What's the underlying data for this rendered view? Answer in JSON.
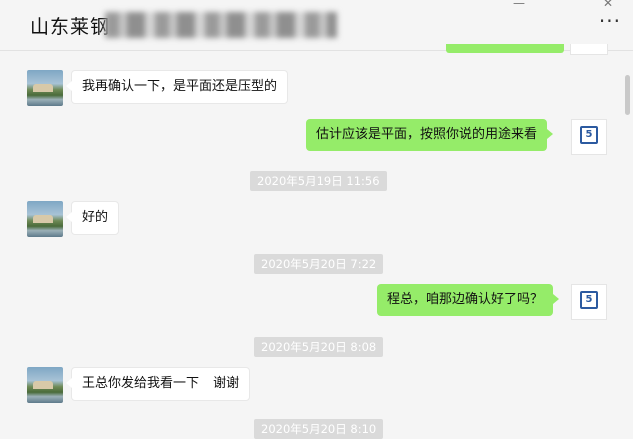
{
  "header": {
    "title": "山东莱钢",
    "more_label": "···",
    "minimize_label": "—",
    "close_label": "✕"
  },
  "messages": [
    {
      "side": "left",
      "text": "我再确认一下，是平面还是压型的"
    },
    {
      "side": "right",
      "text": "估计应该是平面，按照你说的用途来看"
    },
    {
      "side": "left",
      "text": "好的"
    },
    {
      "side": "right",
      "text": "程总，咱那边确认好了吗？"
    },
    {
      "side": "left",
      "text": "王总你发给我看一下"
    },
    {
      "side": "left",
      "text": "谢谢"
    }
  ],
  "timestamps": [
    "2020年5月19日 11:56",
    "2020年5月20日 7:22",
    "2020年5月20日 8:08",
    "2020年5月20日 8:10"
  ],
  "icons": {
    "left_avatar": "landscape-avatar",
    "right_avatar": "company-logo",
    "more": "more-dots-icon"
  },
  "colors": {
    "right_bubble": "#95ec69",
    "left_bubble": "#ffffff",
    "background": "#f5f5f5",
    "timestamp_bg": "#dadada"
  }
}
